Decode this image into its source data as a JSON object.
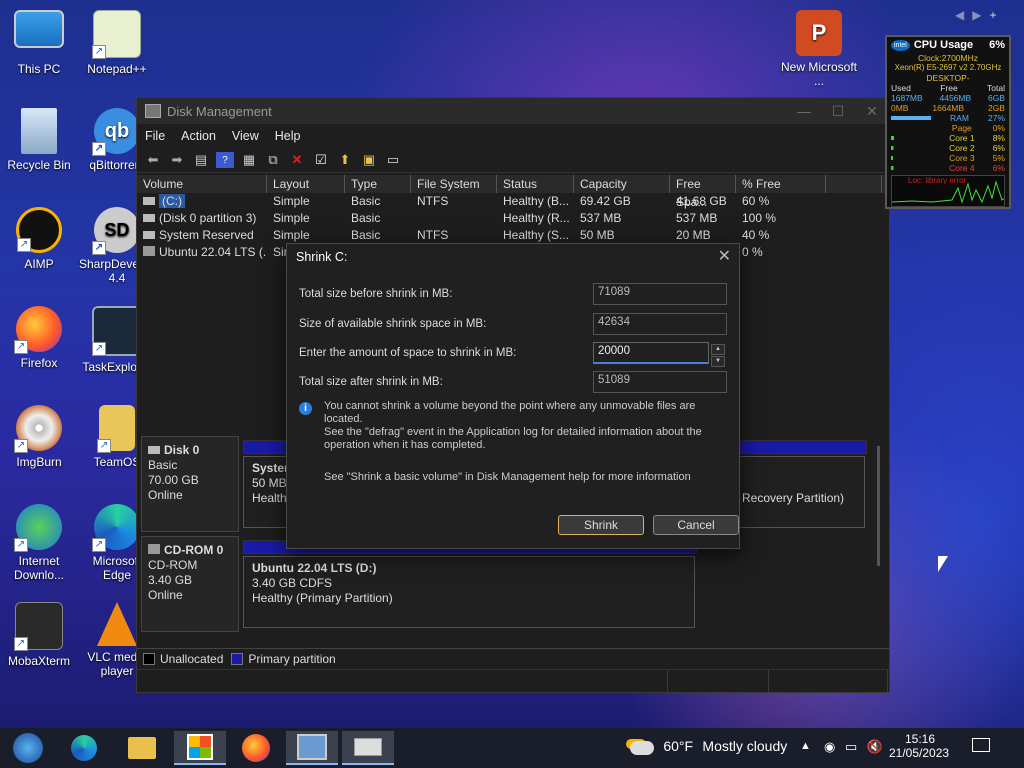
{
  "desktop": {
    "icons": [
      {
        "label": "This PC"
      },
      {
        "label": "Notepad++"
      },
      {
        "label": "New Microsoft ..."
      },
      {
        "label": "Recycle Bin"
      },
      {
        "label": "qBittorrent"
      },
      {
        "label": "AIMP"
      },
      {
        "label": "SharpDevelop 4.4"
      },
      {
        "label": "Firefox"
      },
      {
        "label": "TaskExplorer"
      },
      {
        "label": "ImgBurn"
      },
      {
        "label": "TeamOS"
      },
      {
        "label": "Internet Downlo..."
      },
      {
        "label": "Microsoft Edge"
      },
      {
        "label": "MobaXterm"
      },
      {
        "label": "VLC media player"
      }
    ]
  },
  "disk_mgmt": {
    "title": "Disk Management",
    "menu": [
      "File",
      "Action",
      "View",
      "Help"
    ],
    "columns": [
      "Volume",
      "Layout",
      "Type",
      "File System",
      "Status",
      "Capacity",
      "Free Spa...",
      "% Free"
    ],
    "volumes": [
      {
        "volume": "(C:)",
        "layout": "Simple",
        "type": "Basic",
        "fs": "NTFS",
        "status": "Healthy (B...",
        "capacity": "69.42 GB",
        "free": "41.68 GB",
        "pct": "60 %"
      },
      {
        "volume": "(Disk 0 partition 3)",
        "layout": "Simple",
        "type": "Basic",
        "fs": "",
        "status": "Healthy (R...",
        "capacity": "537 MB",
        "free": "537 MB",
        "pct": "100 %"
      },
      {
        "volume": "System Reserved",
        "layout": "Simple",
        "type": "Basic",
        "fs": "NTFS",
        "status": "Healthy (S...",
        "capacity": "50 MB",
        "free": "20 MB",
        "pct": "40 %"
      },
      {
        "volume": "Ubuntu 22.04 LTS (...",
        "layout": "Simple",
        "type": "",
        "fs": "",
        "status": "",
        "capacity": "",
        "free": "",
        "pct": "0 %"
      }
    ],
    "disks": [
      {
        "name": "Disk 0",
        "type": "Basic",
        "size": "70.00 GB",
        "status": "Online"
      },
      {
        "name": "CD-ROM 0",
        "type": "CD-ROM",
        "size": "3.40 GB",
        "status": "Online"
      }
    ],
    "partitions": {
      "sys_name": "System",
      "sys_size": "50 MB",
      "sys_status": "Healthy",
      "recovery_status": "Recovery Partition)",
      "cd_name": "Ubuntu 22.04 LTS  (D:)",
      "cd_size": "3.40 GB CDFS",
      "cd_status": "Healthy (Primary Partition)"
    },
    "legend": [
      "Unallocated",
      "Primary partition"
    ]
  },
  "dialog": {
    "title": "Shrink C:",
    "total_before_label": "Total size before shrink in MB:",
    "total_before_value": "71089",
    "available_label": "Size of available shrink space in MB:",
    "available_value": "42634",
    "enter_label": "Enter the amount of space to shrink in MB:",
    "enter_value": "20000",
    "after_label": "Total size after shrink in MB:",
    "after_value": "51089",
    "info_line1": "You cannot shrink a volume beyond the point where any unmovable files are located.",
    "info_line2": "See the \"defrag\" event in the Application log for detailed information about the",
    "info_line3": "operation when it has completed.",
    "help_text": "See \"Shrink a basic volume\" in Disk Management help for more information",
    "shrink_btn": "Shrink",
    "cancel_btn": "Cancel"
  },
  "cpu_widget": {
    "title": "CPU Usage",
    "usage": "6%",
    "clock": "Clock:2700MHz",
    "model": "Xeon(R) E5-2697 v2 2.70GHz",
    "host": "DESKTOP-",
    "headers": [
      "Used",
      "Free",
      "Total"
    ],
    "ram_row": [
      "1687MB",
      "4456MB",
      "6GB"
    ],
    "page_row": [
      "0MB",
      "1664MB",
      "2GB"
    ],
    "rows": [
      {
        "label": "RAM",
        "value": "27%"
      },
      {
        "label": "Page",
        "value": "0%"
      },
      {
        "label": "Core 1",
        "value": "8%"
      },
      {
        "label": "Core 2",
        "value": "6%"
      },
      {
        "label": "Core 3",
        "value": "5%"
      },
      {
        "label": "Core 4",
        "value": "6%"
      }
    ],
    "graph_text": "Loc: library error"
  },
  "taskbar": {
    "weather_temp": "60°F",
    "weather_desc": "Mostly cloudy",
    "time": "15:16",
    "date": "21/05/2023"
  }
}
